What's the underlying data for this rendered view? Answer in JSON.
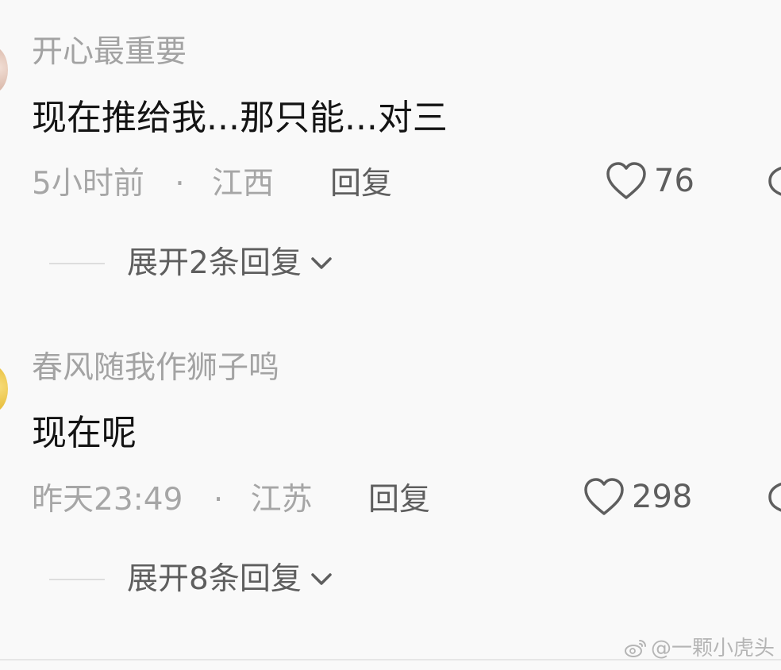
{
  "comments": [
    {
      "username": "开心最重要",
      "text": "现在推给我...那只能...对三",
      "time": "5小时前",
      "separator": "·",
      "location": "江西",
      "reply_label": "回复",
      "likes": "76",
      "expand_label": "展开2条回复"
    },
    {
      "username": "春风随我作狮子鸣",
      "text": "现在呢",
      "time": "昨天23:49",
      "separator": "·",
      "location": "江苏",
      "reply_label": "回复",
      "likes": "298",
      "expand_label": "展开8条回复"
    }
  ],
  "watermark": {
    "text": "@一颗小虎头",
    "icon": "weibo-icon"
  },
  "colors": {
    "background": "#f9f9f9",
    "username": "#a3a3a3",
    "comment_text": "#141414",
    "meta": "#a6a6a6",
    "action": "#5e5e5e"
  }
}
